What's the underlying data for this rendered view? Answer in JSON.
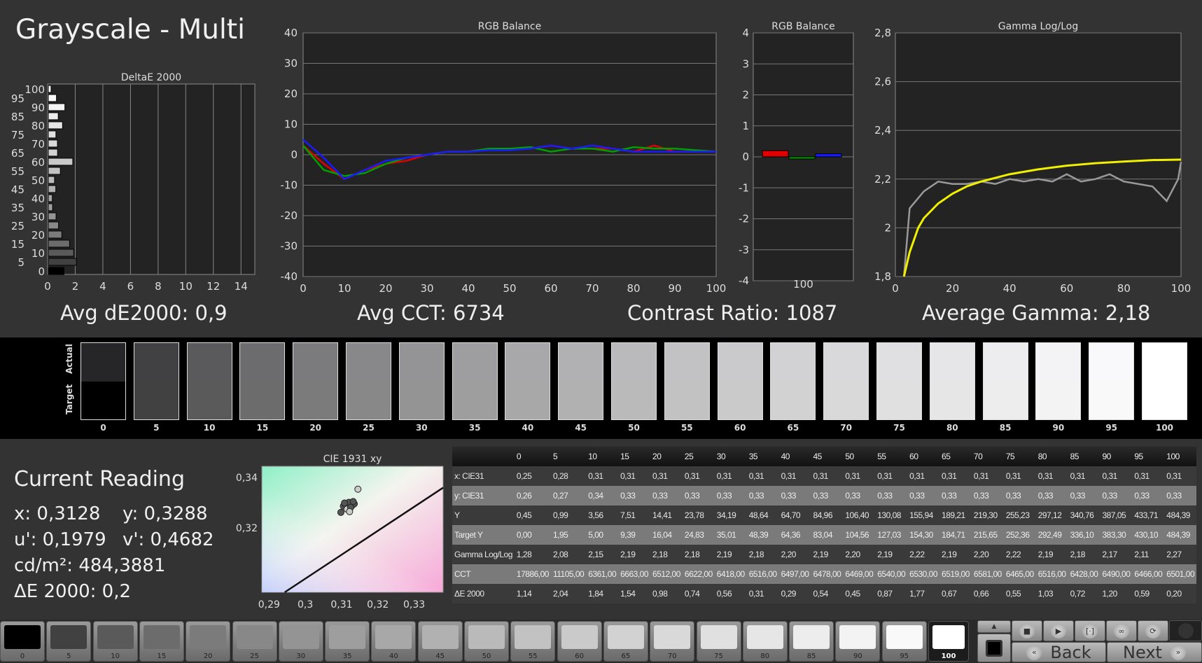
{
  "title": "Grayscale - Multi",
  "summary": {
    "avg_de": "Avg dE2000: 0,9",
    "avg_cct": "Avg CCT: 6734",
    "contrast": "Contrast Ratio: 1087",
    "avg_gamma": "Average Gamma: 2,18"
  },
  "chart_data": [
    {
      "type": "bar",
      "title": "DeltaE 2000",
      "orientation": "horizontal",
      "categories": [
        0,
        5,
        10,
        15,
        20,
        25,
        30,
        35,
        40,
        45,
        50,
        55,
        60,
        65,
        70,
        75,
        80,
        85,
        90,
        95,
        100
      ],
      "values": [
        1.14,
        2.04,
        1.84,
        1.54,
        0.98,
        0.74,
        0.56,
        0.31,
        0.29,
        0.54,
        0.45,
        0.87,
        1.77,
        0.67,
        0.66,
        0.55,
        1.03,
        0.72,
        1.2,
        0.59,
        0.2
      ],
      "xlim": [
        0,
        15
      ],
      "xticks": [
        0,
        2,
        4,
        6,
        8,
        10,
        12,
        14
      ],
      "ylim": [
        0,
        100
      ],
      "grid": true
    },
    {
      "type": "line",
      "title": "RGB Balance",
      "x": [
        0,
        5,
        10,
        15,
        20,
        25,
        30,
        35,
        40,
        45,
        50,
        55,
        60,
        65,
        70,
        75,
        80,
        85,
        90,
        95,
        100
      ],
      "xlim": [
        0,
        100
      ],
      "ylim": [
        -40,
        40
      ],
      "xticks": [
        0,
        10,
        20,
        30,
        40,
        50,
        60,
        70,
        80,
        90,
        100
      ],
      "yticks": [
        -40,
        -30,
        -20,
        -10,
        0,
        10,
        20,
        30,
        40
      ],
      "grid": true,
      "series": [
        {
          "color": "#e00000",
          "values": [
            3,
            -3,
            -8,
            -5,
            -3,
            -2,
            0,
            1,
            1,
            2,
            2,
            2,
            3,
            2,
            2,
            2,
            1,
            3,
            1,
            1,
            1
          ]
        },
        {
          "color": "#00a000",
          "values": [
            3,
            -5,
            -7,
            -6,
            -3,
            -1,
            0,
            1,
            1,
            2,
            2,
            2.5,
            1,
            2,
            2,
            1,
            2.5,
            2,
            2,
            1.5,
            1
          ]
        },
        {
          "color": "#1a1aff",
          "values": [
            5,
            -1,
            -8,
            -5,
            -2,
            -1,
            0,
            1,
            1,
            1.5,
            1.5,
            2,
            3,
            2,
            3,
            2,
            1,
            1,
            1,
            1,
            1
          ]
        }
      ]
    },
    {
      "type": "bar",
      "title": "RGB Balance",
      "categories": [
        "100"
      ],
      "ylim": [
        -4,
        4
      ],
      "yticks": [
        -4,
        -3,
        -2,
        -1,
        0,
        1,
        2,
        3,
        4
      ],
      "grid": true,
      "series": [
        {
          "color": "#e00000",
          "values": [
            0.2
          ]
        },
        {
          "color": "#00a000",
          "values": [
            -0.05
          ]
        },
        {
          "color": "#1a1aff",
          "values": [
            0.1
          ]
        }
      ]
    },
    {
      "type": "line",
      "title": "Gamma Log/Log",
      "xlim": [
        0,
        100
      ],
      "ylim": [
        1.8,
        2.8
      ],
      "xticks": [
        0,
        20,
        40,
        60,
        80,
        100
      ],
      "yticks": [
        "1,8",
        "2",
        "2,2",
        "2,4",
        "2,6",
        "2,8"
      ],
      "grid": true,
      "series": [
        {
          "color": "#999999",
          "x": [
            3,
            5,
            10,
            15,
            20,
            25,
            30,
            35,
            40,
            45,
            50,
            55,
            60,
            65,
            70,
            75,
            80,
            85,
            90,
            95,
            99,
            100
          ],
          "values": [
            1.8,
            2.08,
            2.15,
            2.19,
            2.18,
            2.18,
            2.19,
            2.18,
            2.2,
            2.19,
            2.2,
            2.19,
            2.22,
            2.19,
            2.2,
            2.22,
            2.19,
            2.18,
            2.17,
            2.11,
            2.2,
            2.27
          ]
        },
        {
          "color": "#f0f000",
          "x": [
            3,
            5,
            8,
            10,
            15,
            20,
            25,
            30,
            40,
            50,
            60,
            70,
            80,
            90,
            100
          ],
          "values": [
            1.8,
            1.9,
            2.0,
            2.04,
            2.1,
            2.14,
            2.17,
            2.19,
            2.22,
            2.24,
            2.255,
            2.265,
            2.272,
            2.278,
            2.28
          ]
        }
      ]
    },
    {
      "type": "scatter",
      "title": "CIE 1931 xy",
      "xlim": [
        0.288,
        0.338
      ],
      "ylim": [
        0.2945,
        0.3445
      ],
      "xticks": [
        "0,29",
        "0,3",
        "0,31",
        "0,32",
        "0,33"
      ],
      "yticks": [
        "0,32",
        "0,34"
      ],
      "points": [
        [
          0.3145,
          0.3354
        ],
        [
          0.3105,
          0.3287
        ],
        [
          0.3128,
          0.3288
        ],
        [
          0.311,
          0.3295
        ],
        [
          0.312,
          0.3302
        ],
        [
          0.3135,
          0.3296
        ],
        [
          0.3115,
          0.3275
        ],
        [
          0.3125,
          0.3282
        ],
        [
          0.3098,
          0.3262
        ],
        [
          0.3122,
          0.3265
        ],
        [
          0.3108,
          0.3299
        ],
        [
          0.3132,
          0.3305
        ]
      ]
    }
  ],
  "swatches": {
    "actual_label": "Actual",
    "target_label": "Target",
    "levels": [
      "0",
      "5",
      "10",
      "15",
      "20",
      "25",
      "30",
      "35",
      "40",
      "45",
      "50",
      "55",
      "60",
      "65",
      "70",
      "75",
      "80",
      "85",
      "90",
      "95",
      "100"
    ]
  },
  "current": {
    "heading": "Current Reading",
    "x": "x: 0,3128",
    "y": "y: 0,3288",
    "u": "u': 0,1979",
    "v": "v': 0,4682",
    "cd": "cd/m²: 484,3881",
    "de": "ΔE 2000: 0,2"
  },
  "table": {
    "columns": [
      "",
      "0",
      "5",
      "10",
      "15",
      "20",
      "25",
      "30",
      "35",
      "40",
      "45",
      "50",
      "55",
      "60",
      "65",
      "70",
      "75",
      "80",
      "85",
      "90",
      "95",
      "100"
    ],
    "rows": [
      [
        "x: CIE31",
        "0,25",
        "0,28",
        "0,31",
        "0,31",
        "0,31",
        "0,31",
        "0,31",
        "0,31",
        "0,31",
        "0,31",
        "0,31",
        "0,31",
        "0,31",
        "0,31",
        "0,31",
        "0,31",
        "0,31",
        "0,31",
        "0,31",
        "0,31",
        "0,31"
      ],
      [
        "y: CIE31",
        "0,26",
        "0,27",
        "0,34",
        "0,33",
        "0,33",
        "0,33",
        "0,33",
        "0,33",
        "0,33",
        "0,33",
        "0,33",
        "0,33",
        "0,33",
        "0,33",
        "0,33",
        "0,33",
        "0,33",
        "0,33",
        "0,33",
        "0,33",
        "0,33"
      ],
      [
        "Y",
        "0,45",
        "0,99",
        "3,56",
        "7,51",
        "14,41",
        "23,78",
        "34,19",
        "48,64",
        "64,70",
        "84,96",
        "106,40",
        "130,08",
        "155,94",
        "189,21",
        "219,30",
        "255,23",
        "297,12",
        "340,76",
        "387,05",
        "433,71",
        "484,39"
      ],
      [
        "Target Y",
        "0,00",
        "1,95",
        "5,00",
        "9,39",
        "16,04",
        "24,83",
        "35,01",
        "48,39",
        "64,36",
        "83,04",
        "104,56",
        "127,03",
        "154,30",
        "184,71",
        "215,65",
        "252,36",
        "292,49",
        "336,10",
        "383,30",
        "430,10",
        "484,39"
      ],
      [
        "Gamma Log/Log",
        "1,28",
        "2,08",
        "2,15",
        "2,19",
        "2,18",
        "2,18",
        "2,19",
        "2,18",
        "2,20",
        "2,19",
        "2,20",
        "2,19",
        "2,22",
        "2,19",
        "2,20",
        "2,22",
        "2,19",
        "2,18",
        "2,17",
        "2,11",
        "2,27"
      ],
      [
        "CCT",
        "17886,00",
        "11105,00",
        "6361,00",
        "6663,00",
        "6512,00",
        "6622,00",
        "6418,00",
        "6516,00",
        "6497,00",
        "6478,00",
        "6469,00",
        "6540,00",
        "6530,00",
        "6519,00",
        "6581,00",
        "6465,00",
        "6516,00",
        "6428,00",
        "6490,00",
        "6466,00",
        "6501,00"
      ],
      [
        "ΔE 2000",
        "1,14",
        "2,04",
        "1,84",
        "1,54",
        "0,98",
        "0,74",
        "0,56",
        "0,31",
        "0,29",
        "0,54",
        "0,45",
        "0,87",
        "1,77",
        "0,67",
        "0,66",
        "0,55",
        "1,03",
        "0,72",
        "1,20",
        "0,59",
        "0,20"
      ]
    ]
  },
  "bottom": {
    "patches": [
      "0",
      "5",
      "10",
      "15",
      "20",
      "25",
      "30",
      "35",
      "40",
      "45",
      "50",
      "55",
      "60",
      "65",
      "70",
      "75",
      "80",
      "85",
      "90",
      "95",
      "100"
    ],
    "selected": "100",
    "controls": {
      "up_icon": "triangle-up-icon",
      "stop_icon": "stop-icon",
      "play_icon": "play-icon",
      "bracket_icon": "bracket-icon",
      "loop_icon": "infinity-icon",
      "refresh_icon": "refresh-icon",
      "back": "Back",
      "next": "Next"
    }
  }
}
